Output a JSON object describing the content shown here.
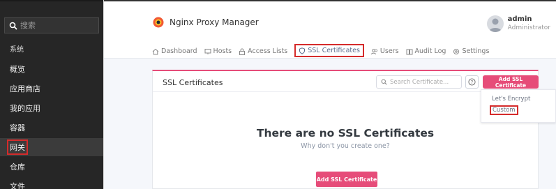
{
  "sidebar": {
    "search_placeholder": "搜索",
    "system": "系统",
    "items": [
      {
        "label": "概览"
      },
      {
        "label": "应用商店"
      },
      {
        "label": "我的应用"
      },
      {
        "label": "容器"
      },
      {
        "label": "网关",
        "active": true
      },
      {
        "label": "仓库"
      },
      {
        "label": "文件"
      }
    ]
  },
  "header": {
    "app_title": "Nginx Proxy Manager",
    "user": {
      "name": "admin",
      "role": "Administrator"
    }
  },
  "nav": {
    "dashboard": "Dashboard",
    "hosts": "Hosts",
    "access_lists": "Access Lists",
    "ssl_certificates": "SSL Certificates",
    "users": "Users",
    "audit_log": "Audit Log",
    "settings": "Settings"
  },
  "card": {
    "title": "SSL Certificates",
    "search_placeholder": "Search Certificate...",
    "help_icon_text": "?",
    "add_button": "Add SSL Certificate",
    "empty_title": "There are no SSL Certificates",
    "empty_subtitle": "Why don't you create one?",
    "empty_add_button": "Add SSL Certificate"
  },
  "dropdown": {
    "items": [
      "Let's Encrypt",
      "Custom"
    ]
  },
  "colors": {
    "accent": "#e64c79",
    "highlight": "#d52b2b",
    "sidebar_bg": "#262626"
  }
}
